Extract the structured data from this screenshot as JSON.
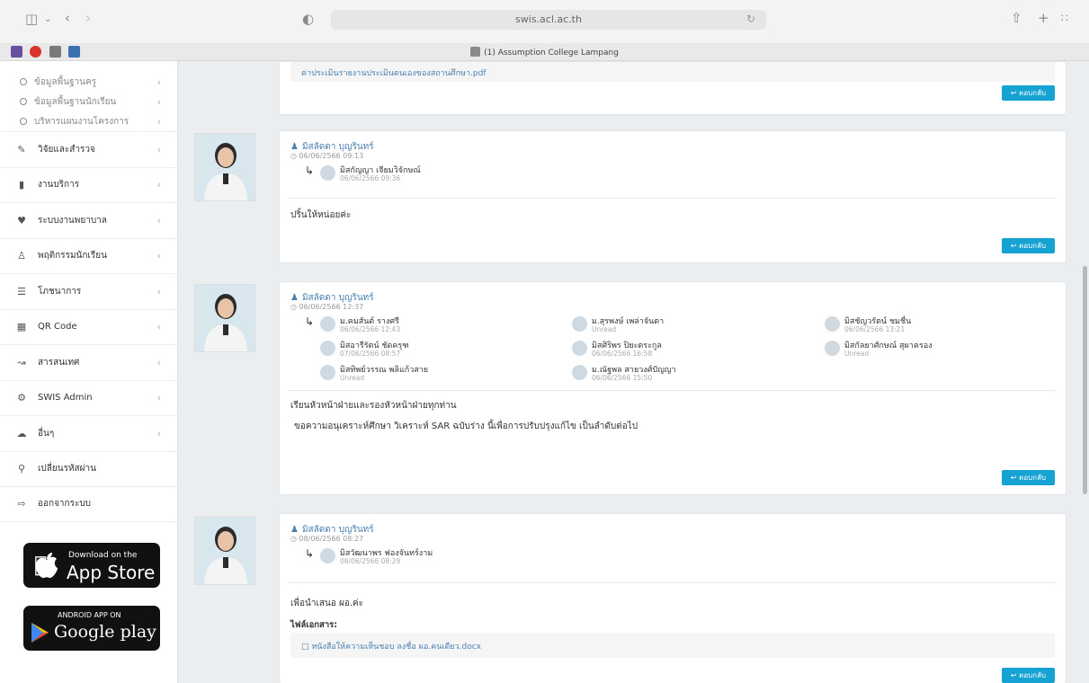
{
  "browser": {
    "url": "swis.acl.ac.th",
    "tab_title": "(1) Assumption College Lampang",
    "colors": {
      "ext1": "#6a4fa0",
      "ext2": "#d9312b",
      "ext3": "#7a7a7a",
      "ext4": "#3a6fb0"
    }
  },
  "sidebar": {
    "sub_items": [
      {
        "label": "ข้อมูลพื้นฐานครู"
      },
      {
        "label": "ข้อมูลพื้นฐานนักเรียน"
      },
      {
        "label": "บริหารแผนงานโครงการ"
      }
    ],
    "items": [
      {
        "label": "วิจัยและสำรวจ",
        "icon": "clipboard-icon"
      },
      {
        "label": "งานบริการ",
        "icon": "book-icon"
      },
      {
        "label": "ระบบงานพยาบาล",
        "icon": "heartbeat-icon"
      },
      {
        "label": "พฤติกรรมนักเรียน",
        "icon": "student-icon"
      },
      {
        "label": "โภชนาการ",
        "icon": "utensils-icon"
      },
      {
        "label": "QR Code",
        "icon": "qrcode-icon"
      },
      {
        "label": "สารสนเทศ",
        "icon": "chart-line-icon"
      },
      {
        "label": "SWIS Admin",
        "icon": "cog-icon"
      },
      {
        "label": "อื่นๆ",
        "icon": "cloud-icon"
      },
      {
        "label": "เปลี่ยนรหัสผ่าน",
        "icon": "key-icon"
      },
      {
        "label": "ออกจากระบบ",
        "icon": "sign-out-icon"
      }
    ],
    "appstore": {
      "small": "Download on the",
      "big": "App Store"
    },
    "googleplay": {
      "small": "ANDROID APP ON",
      "big": "Google play"
    }
  },
  "cards": {
    "top": {
      "attachment": "ค่าประเมินรายงานประเมินตนเองของสถานศึกษา.pdf",
      "reply": "ตอบกลับ"
    },
    "c1": {
      "sender": "มิสลัดดา บุญรินทร์",
      "sent": "06/06/2566 09:13",
      "recipients": [
        {
          "name": "มิสกัญญา เจียมวิจักษณ์",
          "time": "06/06/2566 09:36"
        }
      ],
      "message": "ปริ้นให้หน่อยค่ะ",
      "reply": "ตอบกลับ"
    },
    "c2": {
      "sender": "มิสลัดดา บุญรินทร์",
      "sent": "06/06/2566 12:37",
      "recipients": [
        {
          "name": "ม.คมสันต์ รางศรี",
          "time": "06/06/2566 12:43"
        },
        {
          "name": "ม.สุรพงษ์ เพล่าจันตา",
          "time": "Unread"
        },
        {
          "name": "มิสชัญวรัตน์ ชมชื่น",
          "time": "06/06/2566 13:21"
        },
        {
          "name": "มิสอารีรัตน์ ชัดครุฑ",
          "time": "07/06/2566 08:57"
        },
        {
          "name": "มิสศิริพร ปิยะตระกูล",
          "time": "06/06/2566 16:58"
        },
        {
          "name": "มิสกัลยาศักษณ์ สุผาครอง",
          "time": "Unread"
        },
        {
          "name": "มิสทิพย์วรรณ พลิแก้วสาย",
          "time": "Unread"
        },
        {
          "name": "ม.ณัฐพล สายวงศ์ปัญญา",
          "time": "06/06/2566 15:50"
        }
      ],
      "message1": "เรียนหัวหน้าฝ่ายและรองหัวหน้าฝ่ายทุกท่าน",
      "message2": "ขอความอนุเคราะห์ศึกษา วิเคราะห์ SAR ฉบับร่าง นี้เพื่อการปรับปรุงแก้ไข เป็นลำดับต่อไป",
      "reply": "ตอบกลับ"
    },
    "c3": {
      "sender": "มิสลัดดา บุญรินทร์",
      "sent": "08/06/2566 08:27",
      "recipients": [
        {
          "name": "มิสวัฒนาพร ฟองจันทร์งาม",
          "time": "08/06/2566 08:29"
        }
      ],
      "message": "เพื่อนำเสนอ ผอ.ค่ะ",
      "attach_label": "ไฟล์เอกสาร:",
      "attachment": "หนังสือให้ความเห็นชอบ ลงชื่อ ผอ.คนเดียว.docx",
      "reply": "ตอบกลับ"
    }
  }
}
